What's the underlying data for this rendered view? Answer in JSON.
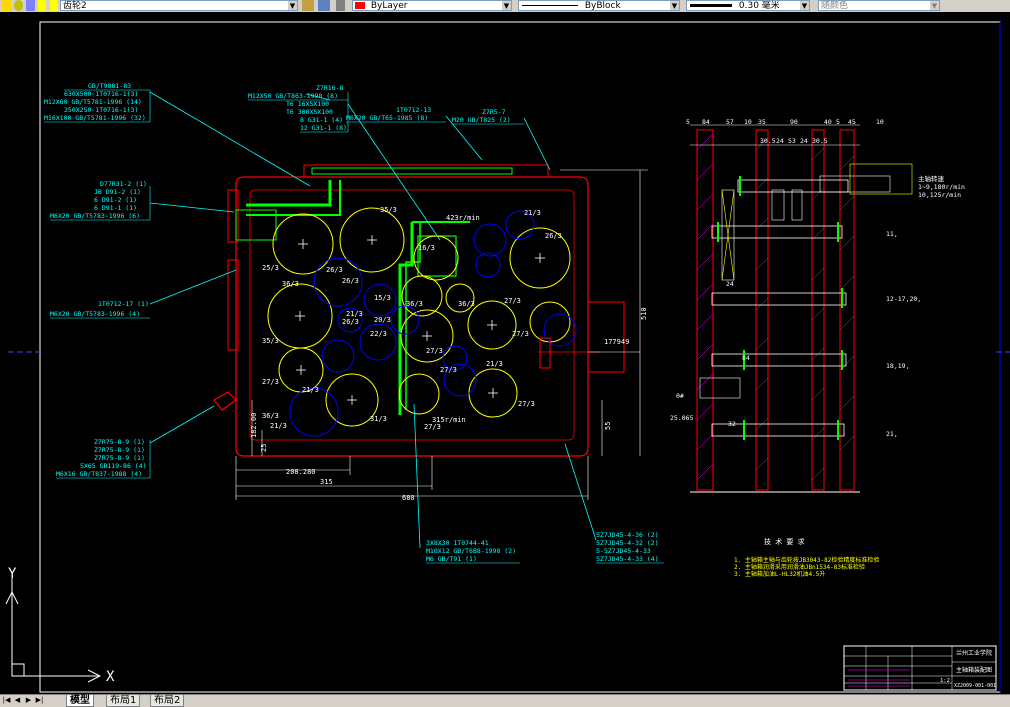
{
  "toolbar": {
    "layer_value": "齿轮2",
    "color_value": "ByLayer",
    "linetype_value": "ByBlock",
    "lineweight_value": "0.30 毫米",
    "plotstyle_value": "随颜色"
  },
  "tabs": [
    {
      "label": "模型",
      "active": true
    },
    {
      "label": "布局1",
      "active": false
    },
    {
      "label": "布局2",
      "active": false
    }
  ],
  "ucs": {
    "x_label": "X",
    "y_label": "Y"
  },
  "callouts": {
    "c1": [
      "GB/T9881-83",
      "630X500-1T0716-1(3)",
      "M12X60 GB/T5781-1996 (14)",
      "250X250-1T0716-1(3)",
      "M16X100 GB/T5781-1996 (32)"
    ],
    "c2": [
      "Z7R16-8",
      "M12X50 GB/T863-1998 (8)",
      "T6 16X5X100",
      "T6 300X5X100",
      "8 G31-1 (4)",
      "12 G31-1 (8)"
    ],
    "c3": [
      "1T0712-13",
      "M6X20 GB/T65-1985 (8)"
    ],
    "c4": [
      "Z7R5-7",
      "M20 GB/T825 (2)"
    ],
    "c5": [
      "D77R31-2 (1)",
      "JB D91-2 (1)",
      "6 D91-2 (1)",
      "6 D91-1 (1)",
      "M6X20 GB/T5783-1996 (6)"
    ],
    "c6": [
      "1T0712-17 (1)",
      "M6X20 GB/T5783-1996 (4)"
    ],
    "c7": [
      "Z7R75-8-9 (1)",
      "Z7R75-8-9 (1)",
      "Z7R75-8-9 (1)",
      "5X65 GB119-86 (4)",
      "M6X16 GB/T837-1988 (4)"
    ],
    "c8": [
      "3X8X30 1T0744-41",
      "M10X12 GB/T6B8-1998 (2)",
      "M6 GB/T91 (1)"
    ],
    "c9": [
      "5Z7JD45-4-36 (2)",
      "5Z7JD45-4-32 (2)",
      "5-5Z7JD45-4-33",
      "5Z7JD45-4-33 (4)"
    ]
  },
  "gear_labels": [
    "35/3",
    "26/3",
    "423r/min",
    "16/3",
    "21/3",
    "26/3",
    "36/3",
    "26/3",
    "25/3",
    "15/3",
    "36/3",
    "36/3",
    "27/3",
    "35/3",
    "21/3",
    "22/3",
    "26/3",
    "20/3",
    "27/3",
    "21/3",
    "36/3",
    "27/3",
    "31/3",
    "27/3",
    "27/3",
    "315r/min",
    "27/3",
    "27/3",
    "21/3",
    "21/3",
    "E",
    "E"
  ],
  "dimensions": {
    "height_510": "510",
    "total_680": "680",
    "w315": "315",
    "w208": "208.280",
    "h182": "182.00",
    "d55": "55",
    "d25": "25",
    "d11": "11",
    "dim_177": "177949",
    "right_top_dims": [
      "5",
      "84",
      "57",
      "10",
      "35",
      "90",
      "40",
      "5",
      "45",
      "10"
    ],
    "right_sub_dims": [
      "30.5",
      "24",
      "53",
      "24",
      "30.5"
    ],
    "right_small": [
      "84",
      "32",
      "24"
    ],
    "right_side_labels": [
      "25.065",
      "0#"
    ]
  },
  "right_view_notes": {
    "speed_label": "主轴转速",
    "speed_1": "1~9,180r/min",
    "speed_2": "10,125r/min",
    "side_nums": [
      "11,",
      "12-17,20,",
      "18,19,",
      "21,"
    ]
  },
  "tech_requirements": {
    "title": "技 术 要 求",
    "items": [
      "1. 主轴箱主轴与齿轮按JB3043-82检验精度标准检验",
      "2. 主轴箱润滑采用润滑油JBn1534-83标准检验",
      "3. 主轴箱加油L-HL32机油4.5升"
    ]
  },
  "title_block": {
    "school": "兰州工业学院",
    "drawing_name": "主轴箱装配图",
    "sheet": "1:2",
    "code": "XZ2009-001-001"
  }
}
